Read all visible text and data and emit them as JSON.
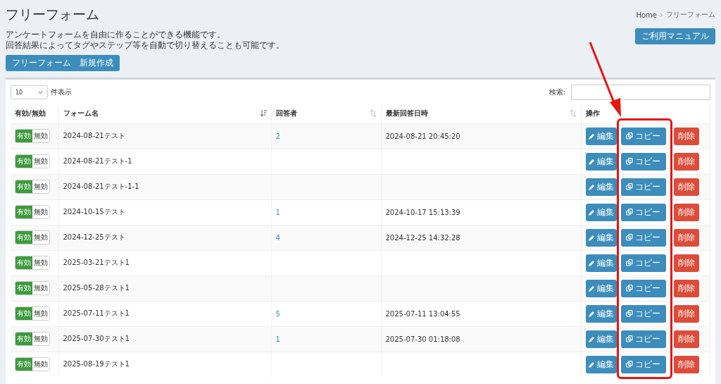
{
  "page": {
    "title": "フリーフォーム",
    "description": [
      "アンケートフォームを自由に作ることができる機能です。",
      "回答結果によってタグやステップ等を自動で切り替えることも可能です。"
    ],
    "create_button": "フリーフォーム　新規作成"
  },
  "breadcrumb": [
    "Home",
    "フリーフォーム"
  ],
  "manual_button": "ご利用マニュアル",
  "length_select": {
    "value": "10",
    "label": "件表示"
  },
  "search": {
    "label": "検索:"
  },
  "table": {
    "columns": [
      {
        "label": "有効/無効",
        "sortable": false
      },
      {
        "label": "フォーム名",
        "sortable": true,
        "sorted": true
      },
      {
        "label": "回答者",
        "sortable": true,
        "sorted": false
      },
      {
        "label": "最新回答日時",
        "sortable": true,
        "sorted": false
      },
      {
        "label": "操作",
        "sortable": false
      }
    ],
    "rows": [
      {
        "toggle": {
          "on_label": "有効",
          "off_label": "無効",
          "on": true
        },
        "name": "2024-08-21テスト",
        "respondents": "2",
        "latest": "2024-08-21 20:45:20",
        "actions": [
          "編集",
          "コピー",
          "削除"
        ]
      },
      {
        "toggle": {
          "on_label": "有効",
          "off_label": "無効",
          "on": true
        },
        "name": "2024-08-21テスト-1",
        "actions": [
          "編集",
          "コピー",
          "削除"
        ]
      },
      {
        "toggle": {
          "on_label": "有効",
          "off_label": "無効",
          "on": true
        },
        "name": "2024-08-21テスト-1-1",
        "actions": [
          "編集",
          "コピー",
          "削除"
        ]
      },
      {
        "toggle": {
          "on_label": "有効",
          "off_label": "無効",
          "on": true
        },
        "name": "2024-10-15テスト",
        "respondents": "1",
        "latest": "2024-10-17 15:13:39",
        "actions": [
          "編集",
          "コピー",
          "削除"
        ]
      },
      {
        "toggle": {
          "on_label": "有効",
          "off_label": "無効",
          "on": true
        },
        "name": "2024-12-25テスト",
        "respondents": "4",
        "latest": "2024-12-25 14:32:28",
        "actions": [
          "編集",
          "コピー",
          "削除"
        ]
      },
      {
        "toggle": {
          "on_label": "有効",
          "off_label": "無効",
          "on": true
        },
        "name": "2025-03-21テスト1",
        "actions": [
          "編集",
          "コピー",
          "削除"
        ]
      },
      {
        "toggle": {
          "on_label": "有効",
          "off_label": "無効",
          "on": true
        },
        "name": "2025-05-28テスト1",
        "actions": [
          "編集",
          "コピー",
          "削除"
        ]
      },
      {
        "toggle": {
          "on_label": "有効",
          "off_label": "無効",
          "on": true
        },
        "name": "2025-07-11テスト1",
        "respondents": "5",
        "latest": "2025-07-11 13:04:55",
        "actions": [
          "編集",
          "コピー",
          "削除"
        ]
      },
      {
        "toggle": {
          "on_label": "有効",
          "off_label": "無効",
          "on": true
        },
        "name": "2025-07-30テスト1",
        "respondents": "1",
        "latest": "2025-07-30 01:18:08",
        "actions": [
          "編集",
          "コピー",
          "削除"
        ]
      },
      {
        "toggle": {
          "on_label": "有効",
          "off_label": "無効",
          "on": true
        },
        "name": "2025-08-19テスト1",
        "actions": [
          "編集",
          "コピー",
          "削除"
        ]
      }
    ]
  }
}
